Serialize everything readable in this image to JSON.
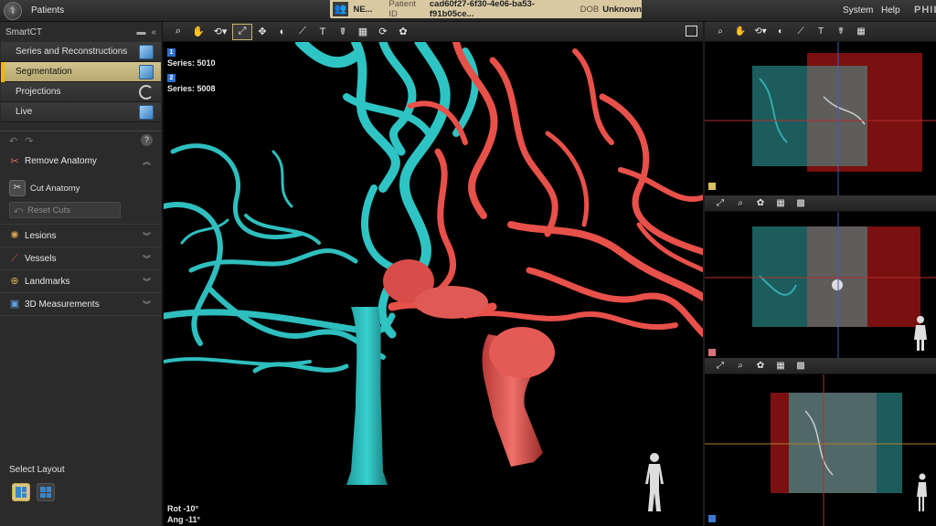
{
  "topbar": {
    "app_icon": "patients-app-icon",
    "patients_label": "Patients",
    "patient": {
      "name": "NE...",
      "patient_id_label": "Patient ID",
      "patient_id": "cad60f27-6f30-4e06-ba53-f91b05ce...",
      "dob_label": "DOB",
      "dob": "Unknown"
    },
    "system_label": "System",
    "help_label": "Help",
    "brand": "PHILIPS"
  },
  "left_panel": {
    "title": "SmartCT",
    "tasks": [
      {
        "label": "Series and Reconstructions",
        "icon": "cube-icon",
        "active": false
      },
      {
        "label": "Segmentation",
        "icon": "cube-select-icon",
        "active": true
      },
      {
        "label": "Projections",
        "icon": "rotate-icon",
        "active": false
      },
      {
        "label": "Live",
        "icon": "live-cube-icon",
        "active": false
      }
    ],
    "remove_anatomy": {
      "label": "Remove Anatomy",
      "cut_anatomy": "Cut Anatomy",
      "reset_cuts": "Reset Cuts"
    },
    "sections": [
      {
        "label": "Lesions",
        "icon": "lesion-icon"
      },
      {
        "label": "Vessels",
        "icon": "vessel-icon"
      },
      {
        "label": "Landmarks",
        "icon": "landmark-icon"
      },
      {
        "label": "3D Measurements",
        "icon": "measurement-icon"
      }
    ],
    "select_layout": "Select Layout"
  },
  "viewport": {
    "series": [
      {
        "badge": "1",
        "label": "Series: 5010",
        "color": "#2fc4c4"
      },
      {
        "badge": "2",
        "label": "Series: 5008",
        "color": "#e8504a"
      }
    ],
    "rotation": "Rot -10°",
    "angulation": "Ang -11°"
  },
  "colors": {
    "accent": "#f2b600",
    "banner": "#d8c9a2",
    "cyan_vessels": "#2fc4c4",
    "red_vessels": "#e8504a",
    "yellow_marker": "#d9c060",
    "pink_marker": "#d9737a",
    "blue_marker": "#3a7ad0"
  }
}
